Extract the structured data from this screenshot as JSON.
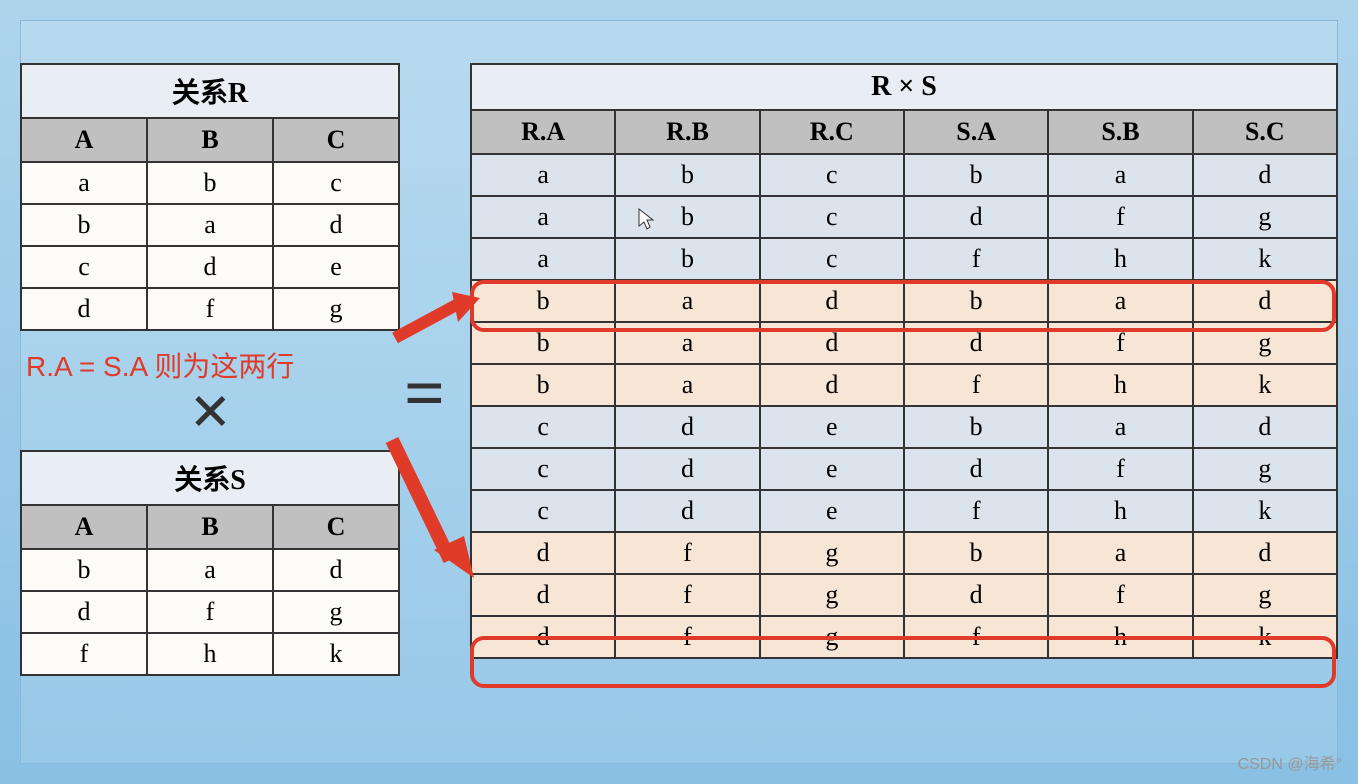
{
  "tables": {
    "R": {
      "title": "关系R",
      "headers": [
        "A",
        "B",
        "C"
      ],
      "rows": [
        [
          "a",
          "b",
          "c"
        ],
        [
          "b",
          "a",
          "d"
        ],
        [
          "c",
          "d",
          "e"
        ],
        [
          "d",
          "f",
          "g"
        ]
      ]
    },
    "S": {
      "title": "关系S",
      "headers": [
        "A",
        "B",
        "C"
      ],
      "rows": [
        [
          "b",
          "a",
          "d"
        ],
        [
          "d",
          "f",
          "g"
        ],
        [
          "f",
          "h",
          "k"
        ]
      ]
    },
    "RS": {
      "title": "R × S",
      "headers": [
        "R.A",
        "R.B",
        "R.C",
        "S.A",
        "S.B",
        "S.C"
      ],
      "rows": [
        [
          "a",
          "b",
          "c",
          "b",
          "a",
          "d"
        ],
        [
          "a",
          "b",
          "c",
          "d",
          "f",
          "g"
        ],
        [
          "a",
          "b",
          "c",
          "f",
          "h",
          "k"
        ],
        [
          "b",
          "a",
          "d",
          "b",
          "a",
          "d"
        ],
        [
          "b",
          "a",
          "d",
          "d",
          "f",
          "g"
        ],
        [
          "b",
          "a",
          "d",
          "f",
          "h",
          "k"
        ],
        [
          "c",
          "d",
          "e",
          "b",
          "a",
          "d"
        ],
        [
          "c",
          "d",
          "e",
          "d",
          "f",
          "g"
        ],
        [
          "c",
          "d",
          "e",
          "f",
          "h",
          "k"
        ],
        [
          "d",
          "f",
          "g",
          "b",
          "a",
          "d"
        ],
        [
          "d",
          "f",
          "g",
          "d",
          "f",
          "g"
        ],
        [
          "d",
          "f",
          "g",
          "f",
          "h",
          "k"
        ]
      ]
    }
  },
  "annotation": "R.A = S.A 则为这两行",
  "operators": {
    "multiply": "×",
    "equals": "="
  },
  "watermark": "CSDN @海希°",
  "colors": {
    "highlight": "#e03a28"
  }
}
